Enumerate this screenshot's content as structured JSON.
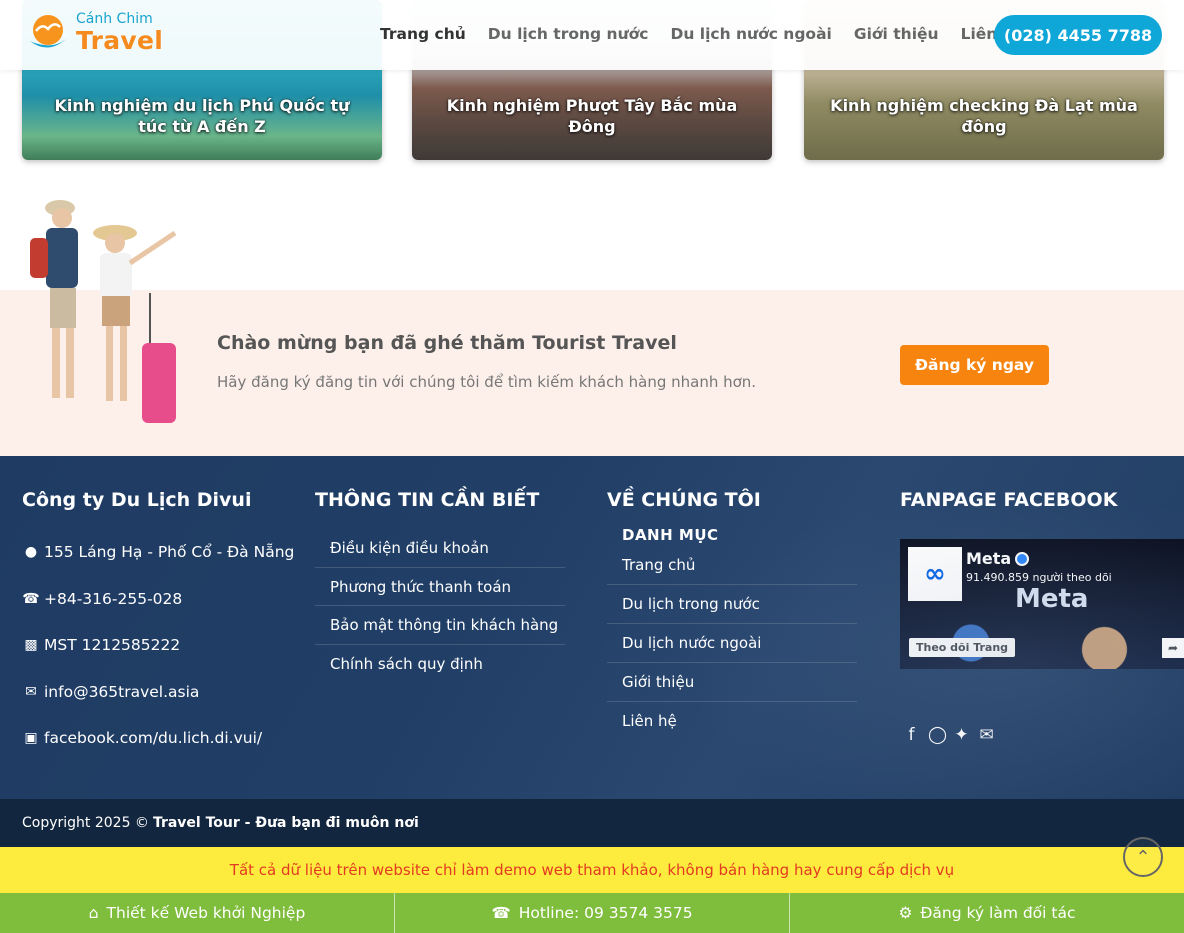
{
  "header": {
    "logo_top": "Cánh Chim",
    "logo_main": "Travel",
    "nav": [
      "Trang chủ",
      "Du lịch trong nước",
      "Du lịch nước ngoài",
      "Giới thiệu",
      "Liên hệ"
    ],
    "hotline": "(028) 4455 7788"
  },
  "cards": [
    {
      "caption": "Kinh nghiệm du lịch Phú Quốc tự túc từ A đến Z"
    },
    {
      "caption": "Kinh nghiệm Phượt Tây Bắc mùa Đông"
    },
    {
      "caption": "Kinh nghiệm checking Đà Lạt mùa đông"
    }
  ],
  "welcome": {
    "title": "Chào mừng bạn đã ghé thăm Tourist Travel",
    "subtitle": "Hãy đăng ký đăng tin với chúng tôi để tìm kiếm khách hàng nhanh hơn.",
    "button": "Đăng ký ngay"
  },
  "footer": {
    "company": {
      "title": "Công ty Du Lịch Divui",
      "address": "155 Láng Hạ - Phố Cổ - Đà Nẵng",
      "phone": "+84-316-255-028",
      "tax": "MST 1212585222",
      "email": "info@365travel.asia",
      "facebook": "facebook.com/du.lich.di.vui/"
    },
    "info": {
      "title": "THÔNG TIN CẦN BIẾT",
      "links": [
        "Điều kiện điều khoản",
        "Phương thức thanh toán",
        "Bảo mật thông tin khách hàng",
        "Chính sách quy định"
      ]
    },
    "about": {
      "title": "VỀ CHÚNG TÔI",
      "subtitle": "DANH MỤC",
      "links": [
        "Trang chủ",
        "Du lịch trong nước",
        "Du lịch nước ngoài",
        "Giới thiệu",
        "Liên hệ"
      ]
    },
    "fanpage": {
      "title": "FANPAGE FACEBOOK",
      "page_name": "Meta",
      "followers": "91.490.859 người theo dõi",
      "brand": "Meta",
      "follow_button": "Theo dõi Trang"
    }
  },
  "copyright": {
    "prefix": "Copyright 2025 ©",
    "strong": "Travel Tour - Đưa bạn đi muôn nơi"
  },
  "notice": "Tất cả dữ liệu trên website chỉ làm demo web tham khảo, không bán hàng hay cung cấp dịch vụ",
  "bottom_bar": [
    {
      "icon": "home-icon",
      "label": "Thiết kế Web khởi Nghiệp"
    },
    {
      "icon": "phone-icon",
      "label": "Hotline: 09 3574 3575"
    },
    {
      "icon": "gear-icon",
      "label": "Đăng ký làm đối tác"
    }
  ],
  "colors": {
    "brand_orange": "#f58a1f",
    "brand_blue": "#0fa7d8",
    "footer_bg": "#213f66",
    "notice_bg": "#fdeb3d",
    "bottom_bar_bg": "#7fbd3d"
  }
}
